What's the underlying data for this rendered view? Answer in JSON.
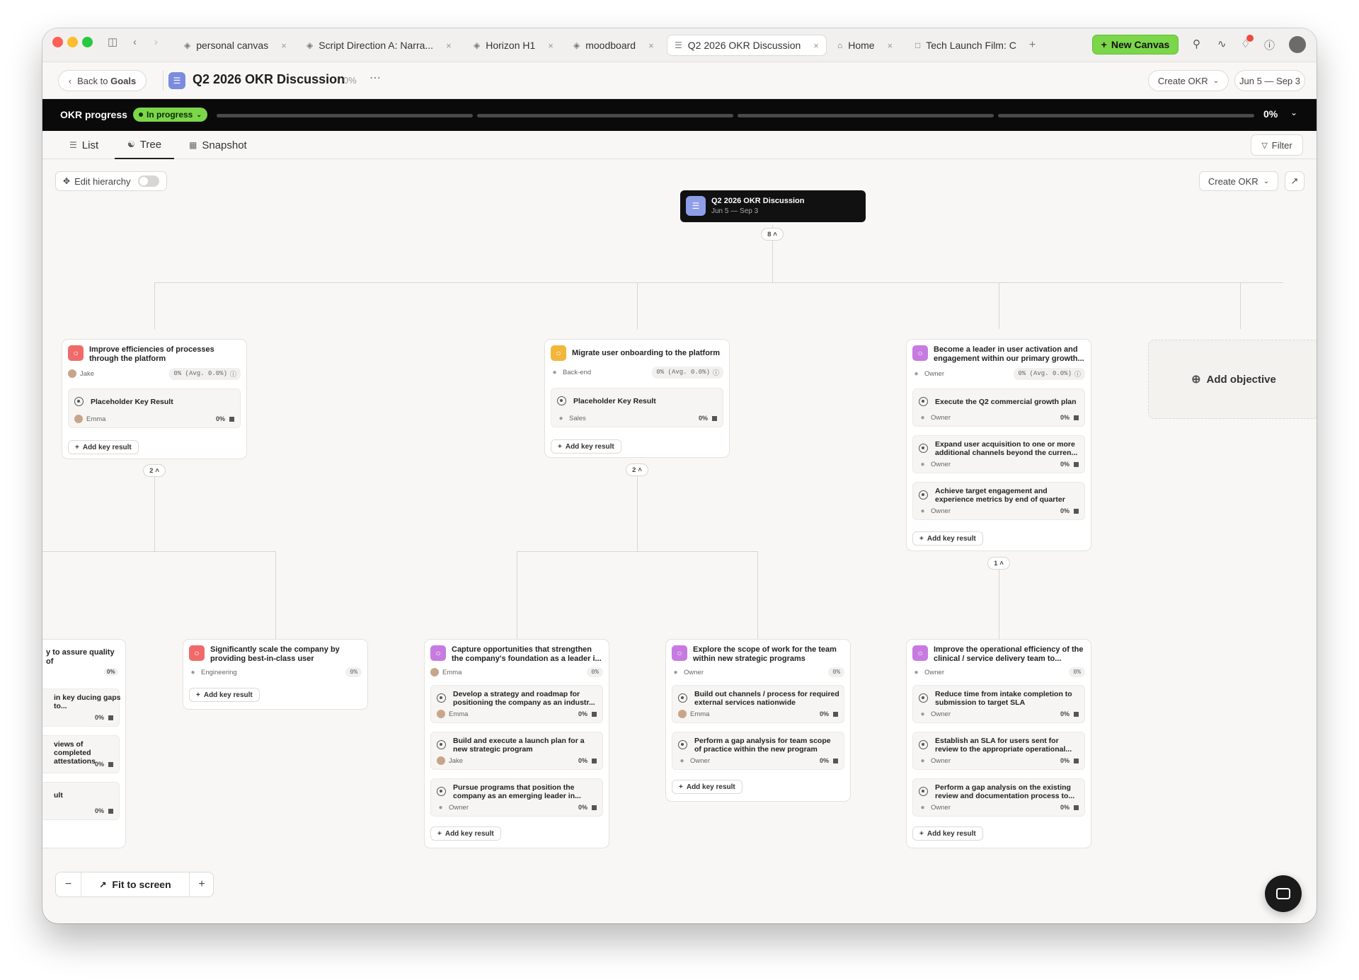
{
  "window": {
    "tabs": [
      {
        "label": "personal canvas",
        "icon": "layers-icon"
      },
      {
        "label": "Script Direction A: Narra...",
        "icon": "layers-icon"
      },
      {
        "label": "Horizon H1",
        "icon": "layers-icon"
      },
      {
        "label": "moodboard",
        "icon": "layers-icon"
      },
      {
        "label": "Q2 2026 OKR Discussion",
        "icon": "list-icon"
      },
      {
        "label": "Home",
        "icon": "home-icon"
      },
      {
        "label": "Tech Launch Film: C",
        "icon": "folder-icon"
      }
    ],
    "new_canvas_label": "New Canvas",
    "notification_badge_color": "#f04a3e"
  },
  "header": {
    "back_prefix": "Back to",
    "back_target": "Goals",
    "title": "Q2 2026 OKR Discussion",
    "progress": "0%",
    "create_okr_label": "Create OKR",
    "date_range": "Jun 5 — Sep 3"
  },
  "progress_bar": {
    "label": "OKR progress",
    "status": "In progress",
    "status_color": "#7cd64a",
    "value": "0%",
    "segments": 4
  },
  "view_tabs": [
    {
      "label": "List",
      "icon": "list-icon"
    },
    {
      "label": "Tree",
      "icon": "tree-icon"
    },
    {
      "label": "Snapshot",
      "icon": "grid-icon"
    }
  ],
  "active_view": "Tree",
  "filter_label": "Filter",
  "canvas": {
    "edit_hierarchy_label": "Edit hierarchy",
    "create_okr_label": "Create OKR",
    "root": {
      "title": "Q2 2026 OKR Discussion",
      "dates": "Jun 5 — Sep 3",
      "child_count": "8"
    },
    "add_objective_label": "Add objective",
    "add_key_result_label": "Add key result",
    "objectives": [
      {
        "title": "Improve efficiencies of processes through the platform",
        "owner": "Jake",
        "progress": "0% (Avg. 0.0%)",
        "icon_color": "#f06a6a",
        "child_count": "2",
        "key_results": [
          {
            "title": "Placeholder Key Result",
            "owner": "Emma",
            "progress": "0%"
          }
        ]
      },
      {
        "title": "Migrate user onboarding to the platform",
        "owner": "Back-end",
        "progress": "0% (Avg. 0.0%)",
        "icon_color": "#f2b63a",
        "child_count": "2",
        "key_results": [
          {
            "title": "Placeholder Key Result",
            "owner": "Sales",
            "progress": "0%"
          }
        ]
      },
      {
        "title": "Become a leader in user activation and engagement within our primary growth...",
        "owner": "Owner",
        "progress": "0% (Avg. 0.0%)",
        "icon_color": "#c77be0",
        "child_count": "1",
        "key_results": [
          {
            "title": "Execute the Q2 commercial growth plan",
            "owner": "Owner",
            "progress": "0%"
          },
          {
            "title": "Expand user acquisition to one or more additional channels beyond the curren...",
            "owner": "Owner",
            "progress": "0%"
          },
          {
            "title": "Achieve target engagement and experience metrics by end of quarter",
            "owner": "Owner",
            "progress": "0%"
          }
        ]
      }
    ],
    "sub_objectives": [
      {
        "title": "y to assure quality of",
        "owner": "",
        "progress": "0%",
        "key_results": [
          {
            "title": "in key ducing gaps to...",
            "owner": "",
            "progress": "0%"
          },
          {
            "title": "views of completed attestations",
            "owner": "",
            "progress": "0%"
          },
          {
            "title": "ult",
            "owner": "",
            "progress": "0%"
          }
        ]
      },
      {
        "title": "Significantly scale the company by providing best-in-class user experience...",
        "owner": "Engineering",
        "progress": "0%",
        "icon_color": "#f06a6a",
        "key_results": []
      },
      {
        "title": "Capture opportunities that strengthen the company's foundation as a leader i...",
        "owner": "Emma",
        "progress": "0%",
        "icon_color": "#c77be0",
        "key_results": [
          {
            "title": "Develop a strategy and roadmap for positioning the company as an industr...",
            "owner": "Emma",
            "progress": "0%"
          },
          {
            "title": "Build and execute a launch plan for a new strategic program",
            "owner": "Jake",
            "progress": "0%"
          },
          {
            "title": "Pursue programs that position the company as an emerging leader in...",
            "owner": "Owner",
            "progress": "0%"
          }
        ]
      },
      {
        "title": "Explore the scope of work for the team within new strategic programs",
        "owner": "Owner",
        "progress": "0%",
        "icon_color": "#c77be0",
        "key_results": [
          {
            "title": "Build out channels / process for required external services nationwide",
            "owner": "Emma",
            "progress": "0%"
          },
          {
            "title": "Perform a gap analysis for team scope of practice within the new program",
            "owner": "Owner",
            "progress": "0%"
          }
        ]
      },
      {
        "title": "Improve the operational efficiency of the clinical / service delivery team to...",
        "owner": "Owner",
        "progress": "0%",
        "icon_color": "#c77be0",
        "key_results": [
          {
            "title": "Reduce time from intake completion to submission to target SLA",
            "owner": "Owner",
            "progress": "0%"
          },
          {
            "title": "Establish an SLA for users sent for review to the appropriate operational...",
            "owner": "Owner",
            "progress": "0%"
          },
          {
            "title": "Perform a gap analysis on the existing review and documentation process to...",
            "owner": "Owner",
            "progress": "0%"
          }
        ]
      }
    ]
  },
  "zoom": {
    "fit_label": "Fit to screen"
  }
}
